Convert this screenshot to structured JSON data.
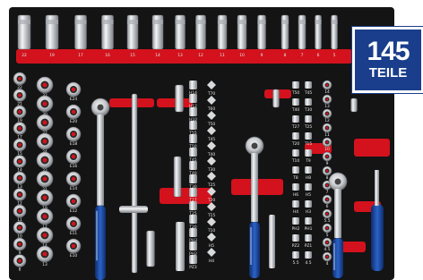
{
  "badge": {
    "count": "145",
    "unit": "TEILE"
  },
  "colors": {
    "foam": "#141414",
    "holder": "#d3121d",
    "chrome": "#c9ccd0",
    "handle": "#1c4fa8"
  },
  "top_row_labels": [
    "22",
    "19",
    "17",
    "16",
    "15",
    "14",
    "13",
    "12",
    "11",
    "10",
    "9",
    "8",
    "7",
    "6",
    "5"
  ],
  "left_sockets": {
    "col1": [
      "22",
      "21",
      "19",
      "17",
      "15",
      "14",
      "13",
      "12",
      "11",
      "10",
      "9",
      "8"
    ],
    "col2": [
      "32",
      "30",
      "27",
      "24",
      "22",
      "21",
      "19",
      "17",
      "14",
      "13"
    ],
    "col3": [
      "E24",
      "E20",
      "E18",
      "E16",
      "E14",
      "E12",
      "E11",
      "E10"
    ]
  },
  "bits_col1": [
    "H14",
    "H12",
    "H10",
    "T55",
    "T50",
    "T45",
    "T40",
    "T30",
    "T27",
    "T25",
    "T20",
    "PH3",
    "PH2",
    "PZ3"
  ],
  "bits_col2": [
    "T70",
    "T60",
    "T50",
    "T45",
    "T40",
    "T30",
    "T25",
    "T20",
    "T15",
    "T10",
    "H5",
    "H4"
  ],
  "bits_right": [
    "T50",
    "T45",
    "T40",
    "T30",
    "T27",
    "T25",
    "T20",
    "T15",
    "T10",
    "T9",
    "T8",
    "H8",
    "H6",
    "H5",
    "H4",
    "H3",
    "PH2",
    "PH1",
    "PZ2",
    "PZ1",
    "5.5",
    "4.5"
  ],
  "small_sockets": [
    "14",
    "13",
    "12",
    "11",
    "10",
    "9",
    "8",
    "7",
    "6",
    "5.5",
    "5",
    "4.5",
    "4"
  ]
}
